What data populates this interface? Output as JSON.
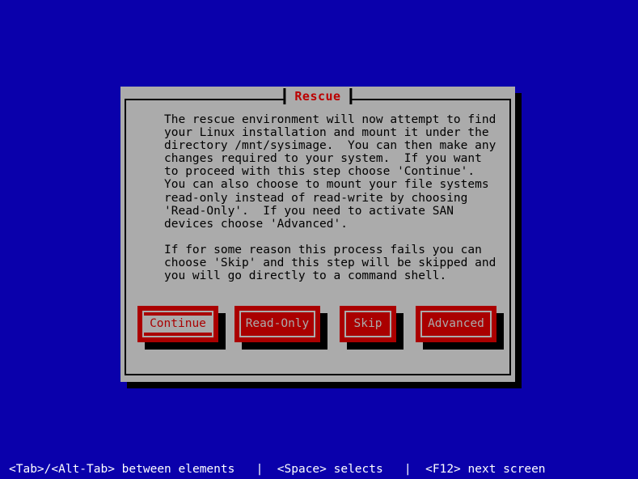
{
  "screen": {
    "background_color": "#0a00ab",
    "dialog_color": "#ababab",
    "accent_red": "#aa0000",
    "title_red": "#bb0000",
    "text_color": "#000000",
    "footer_text_color": "#ffffff"
  },
  "dialog": {
    "title": "Rescue",
    "body": "The rescue environment will now attempt to find\nyour Linux installation and mount it under the\ndirectory /mnt/sysimage.  You can then make any\nchanges required to your system.  If you want\nto proceed with this step choose 'Continue'.\nYou can also choose to mount your file systems\nread-only instead of read-write by choosing\n'Read-Only'.  If you need to activate SAN\ndevices choose 'Advanced'.\n\nIf for some reason this process fails you can\nchoose 'Skip' and this step will be skipped and\nyou will go directly to a command shell.",
    "buttons": [
      {
        "label": "Continue",
        "focused": true
      },
      {
        "label": "Read-Only",
        "focused": false
      },
      {
        "label": "Skip",
        "focused": false
      },
      {
        "label": "Advanced",
        "focused": false
      }
    ]
  },
  "footer": {
    "hint_1": "<Tab>/<Alt-Tab> between elements",
    "separator_1": "|",
    "hint_2": "<Space> selects",
    "separator_2": "|",
    "hint_3": "<F12> next screen"
  }
}
